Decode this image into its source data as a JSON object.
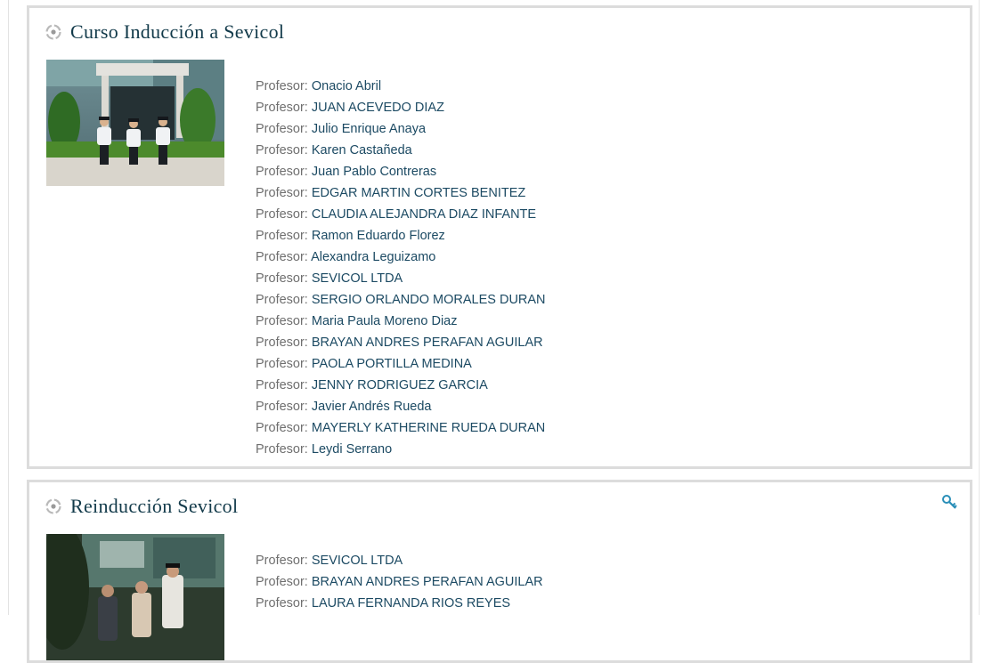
{
  "colors": {
    "title": "#123a4a",
    "label": "#6f6f6f",
    "link": "#1c4a63",
    "border": "#dcdcdc",
    "accent": "#2a8fb8"
  },
  "courses": [
    {
      "title": "Curso Inducción a Sevicol",
      "icon": "course-icon",
      "image": "guards-at-entrance-photo",
      "teachers": [
        {
          "label": "Profesor:",
          "name": "Onacio Abril"
        },
        {
          "label": "Profesor:",
          "name": "JUAN ACEVEDO DIAZ"
        },
        {
          "label": "Profesor:",
          "name": "Julio Enrique Anaya"
        },
        {
          "label": "Profesor:",
          "name": "Karen Castañeda"
        },
        {
          "label": "Profesor:",
          "name": "Juan Pablo Contreras"
        },
        {
          "label": "Profesor:",
          "name": "EDGAR MARTIN CORTES BENITEZ"
        },
        {
          "label": "Profesor:",
          "name": "CLAUDIA ALEJANDRA DIAZ INFANTE"
        },
        {
          "label": "Profesor:",
          "name": "Ramon Eduardo Florez"
        },
        {
          "label": "Profesor:",
          "name": "Alexandra Leguizamo"
        },
        {
          "label": "Profesor:",
          "name": "SEVICOL LTDA"
        },
        {
          "label": "Profesor:",
          "name": "SERGIO ORLANDO MORALES DURAN"
        },
        {
          "label": "Profesor:",
          "name": "Maria Paula Moreno Diaz"
        },
        {
          "label": "Profesor:",
          "name": "BRAYAN ANDRES PERAFAN AGUILAR"
        },
        {
          "label": "Profesor:",
          "name": "PAOLA PORTILLA MEDINA"
        },
        {
          "label": "Profesor:",
          "name": "JENNY RODRIGUEZ GARCIA"
        },
        {
          "label": "Profesor:",
          "name": "Javier Andrés Rueda"
        },
        {
          "label": "Profesor:",
          "name": "MAYERLY KATHERINE RUEDA DURAN"
        },
        {
          "label": "Profesor:",
          "name": "Leydi Serrano"
        }
      ]
    },
    {
      "title": "Reinducción Sevicol",
      "icon": "course-icon",
      "image": "guard-greeting-visitors-photo",
      "enrolment_icon": "key-icon",
      "teachers": [
        {
          "label": "Profesor:",
          "name": "SEVICOL LTDA"
        },
        {
          "label": "Profesor:",
          "name": "BRAYAN ANDRES PERAFAN AGUILAR"
        },
        {
          "label": "Profesor:",
          "name": "LAURA FERNANDA RIOS REYES"
        }
      ]
    }
  ]
}
